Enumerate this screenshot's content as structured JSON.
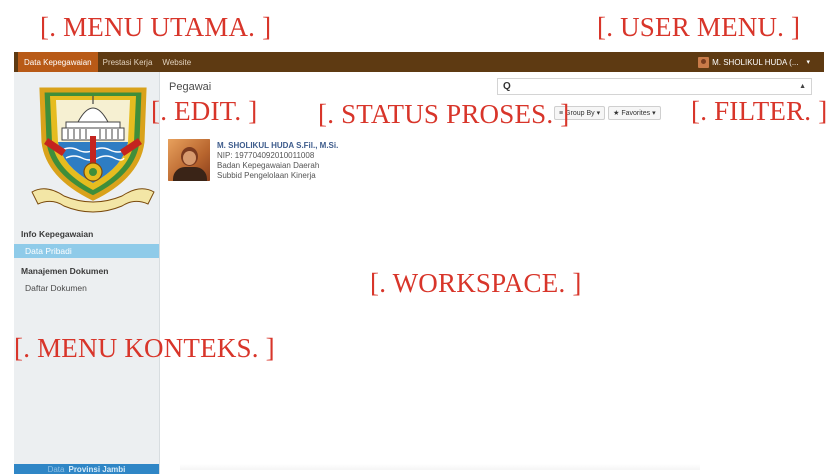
{
  "annotations": {
    "menu_utama": "[. MENU UTAMA. ]",
    "user_menu": "[. USER MENU. ]",
    "edit": "[. EDIT. ]",
    "status_proses": "[. STATUS PROSES. ]",
    "filter": "[. FILTER. ]",
    "workspace": "[. WORKSPACE. ]",
    "menu_konteks": "[. MENU KONTEKS. ]"
  },
  "topbar": {
    "items": [
      "Data Kepegawaian",
      "Prestasi Kerja",
      "Website"
    ],
    "active_index": 0,
    "user_name": "M. SHOLIKUL HUDA (...",
    "caret": "▾"
  },
  "sidebar": {
    "logo_motto": "SEPUCUK JAMBI SEMBILAN LURAH",
    "sections": [
      {
        "title": "Info Kepegawaian",
        "items": [
          {
            "label": "Data Pribadi",
            "active": true
          }
        ]
      },
      {
        "title": "Manajemen Dokumen",
        "items": [
          {
            "label": "Daftar Dokumen",
            "active": false
          }
        ]
      }
    ],
    "footer_dim": "Data",
    "footer": "Provinsi Jambi"
  },
  "main": {
    "title": "Pegawai",
    "search": {
      "icon": "Q",
      "value": "",
      "placeholder": ""
    },
    "filters": [
      {
        "icon": "≡",
        "label": "Group By"
      },
      {
        "icon": "★",
        "label": "Favorites"
      }
    ],
    "employee": {
      "name": "M. SHOLIKUL HUDA S.Fil., M.Si.",
      "nip": "NIP: 197704092010011008",
      "org": "Badan Kepegawaian Daerah",
      "unit": "Subbid Pengelolaan Kinerja"
    }
  },
  "colors": {
    "topbar": "#5e3a12",
    "active_menu": "#b85a17",
    "sidebar_active": "#8fcbe9",
    "annotation": "#d8352a"
  }
}
